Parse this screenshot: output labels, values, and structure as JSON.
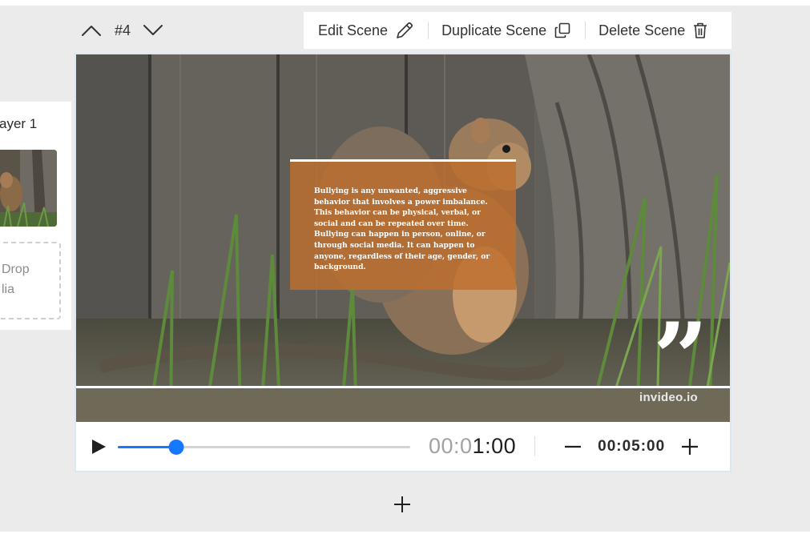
{
  "layer_panel": {
    "title": "ayer 1",
    "drop_zone_text": "Drop\nlia"
  },
  "scene_nav": {
    "scene_number": "#4"
  },
  "toolbar": {
    "edit_label": "Edit Scene",
    "duplicate_label": "Duplicate Scene",
    "delete_label": "Delete Scene"
  },
  "video": {
    "overlay_text": "Bullying is any unwanted, aggressive behavior that involves a power imbalance. This behavior can be physical, verbal, or social and can be repeated over time. Bullying can happen in person, online, or through social media. It can happen to anyone, regardless of their age, gender, or background.",
    "quote_mark": "”",
    "watermark": "invideo.io"
  },
  "player": {
    "time_dim": "00:0",
    "time_bright": "1:00",
    "progress_fraction": 0.2,
    "duration": "00:05:00"
  },
  "colors": {
    "accent": "#1677ff",
    "overlay": "#be6e2d"
  },
  "icons": [
    "chevron-up-icon",
    "chevron-down-icon",
    "pencil-icon",
    "duplicate-icon",
    "trash-icon",
    "play-icon",
    "minus-icon",
    "plus-icon"
  ]
}
